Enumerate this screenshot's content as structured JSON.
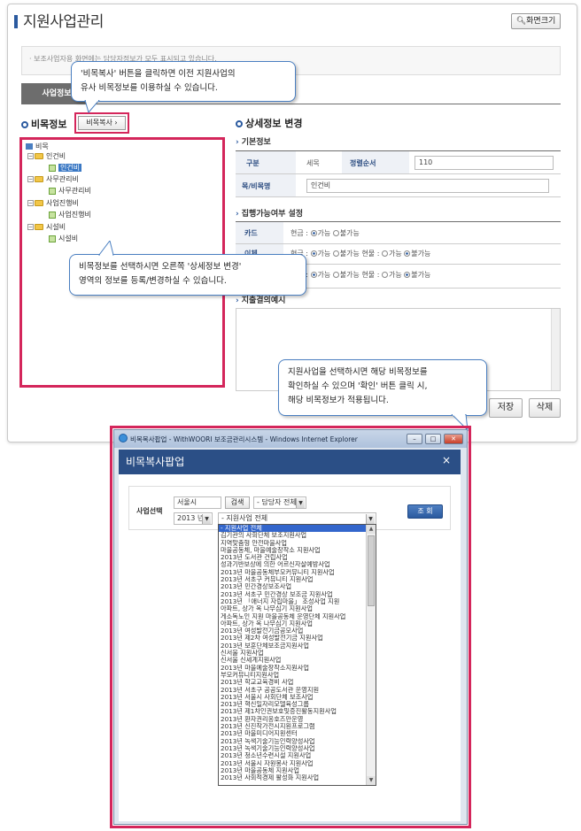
{
  "page_title": "지원사업관리",
  "screen_size_label": "화면크기",
  "notice_text": "· 보조사업자용 화면에는 담당자정보가 모두 표시되고 있습니다.",
  "tab_label": "사업정보",
  "left_section_title": "비목정보",
  "copy_button_label": "비목복사",
  "tree": {
    "root": "비목",
    "groups": [
      {
        "label": "인건비",
        "child": "인건비"
      },
      {
        "label": "사무관리비",
        "child": "사무관리비"
      },
      {
        "label": "사업진행비",
        "child": "사업진행비"
      },
      {
        "label": "시설비",
        "child": "시설비"
      }
    ]
  },
  "right_section_title": "상세정보 변경",
  "basic_info": {
    "heading": "기본정보",
    "category_label": "구분",
    "category_value": "세목",
    "order_label": "정렬순서",
    "order_value": "110",
    "name_label": "목/비목명",
    "name_value": "인건비"
  },
  "exec": {
    "heading": "집행가능여부 설정",
    "card_label": "카드",
    "card_text": "현금 : ",
    "transfer_label": "이체",
    "third_label": "",
    "opt_ok": "가능",
    "opt_no": "불가능",
    "goods_text": "현물 : "
  },
  "memo_heading": "지출결의예시",
  "buttons": {
    "save": "저장",
    "delete": "삭제"
  },
  "callouts": {
    "copy": [
      "'비목복사' 버튼을 클릭하면 이전 지원사업의",
      "유사 비목정보를 이용하실 수 있습니다."
    ],
    "tree": [
      "비목정보를 선택하시면 오른쪽 '상세정보 변경'",
      "영역의 정보를 등록/변경하실 수 있습니다."
    ],
    "popup": [
      "지원사업을 선택하시면 해당 비목정보를",
      "확인하실 수 있으며 '확인' 버튼 클릭 시,",
      "해당 비목정보가 적용됩니다."
    ]
  },
  "popup": {
    "window_title": "비목복사팝업 - WithWOORI 보조금관리시스템 - Windows Internet Explorer",
    "title": "비목복사팝업",
    "close_glyph": "×",
    "search_label": "사업선택",
    "region_value": "서울시",
    "search_button": "검색",
    "manager_select": "- 담당자 전체",
    "year_select": "2013 년",
    "project_select": "- 지원사업 전체",
    "query_button": "조 회",
    "options": [
      "- 지원사업 전체",
      "김기관의 사회단체 보조지원사업",
      "지역맞춤형 안전마을사업",
      "마을공동체, 마을예술창작소 지원사업",
      "2013년 도서관 건립사업",
      "성과기반보상에 의한 어르신자살예방사업",
      "2013년 마을공동체부모커뮤니티 지원사업",
      "2013년 서초구 커뮤니티 지원사업",
      "2013년 민간경상보조사업",
      "2013년 서초구 민간경상 보조금 지원사업",
      "2013년 「애너지 자립마을」 조성사업 지원",
      "아파트, 상가 옥 나무심기 지원사업",
      "게소독노인 지원 마을공동체 운영단체 지원사업",
      "아파트, 상가 옥 나무심기 지원사업",
      "2013년 여성발전기금공모사업",
      "2013년 제2차 여성발전기금 지원사업",
      "2013년 보훈단체보조금지원사업",
      "신서울 지원사업",
      "신서울 신세계지원사업",
      "2013년 마을예술창작소지원사업",
      "부모커뮤니티지원사업",
      "2013년 학교교육경비 사업",
      "2013년 서초구 공공도서관 운영지원",
      "2013년 서울시 사회단체 보조사업",
      "2013년 혁신일자리모델육성그룹",
      "2013년 제1차인권보호및증진활동지원사업",
      "2013년 환자권리옹호즈만운영",
      "2013년 신진작가전시지원프로그램",
      "2013년 마을미디어지원센터",
      "2013년 녹색기술기능인력양성사업",
      "2013년 녹색기술기능인력양성사업",
      "2013년 청소년수련시설 지원사업",
      "2013년 서울시 자원봉사 지원사업",
      "2013년 마을공동체 지원사업",
      "2013년 사회적경제 활성화 지원사업"
    ]
  }
}
